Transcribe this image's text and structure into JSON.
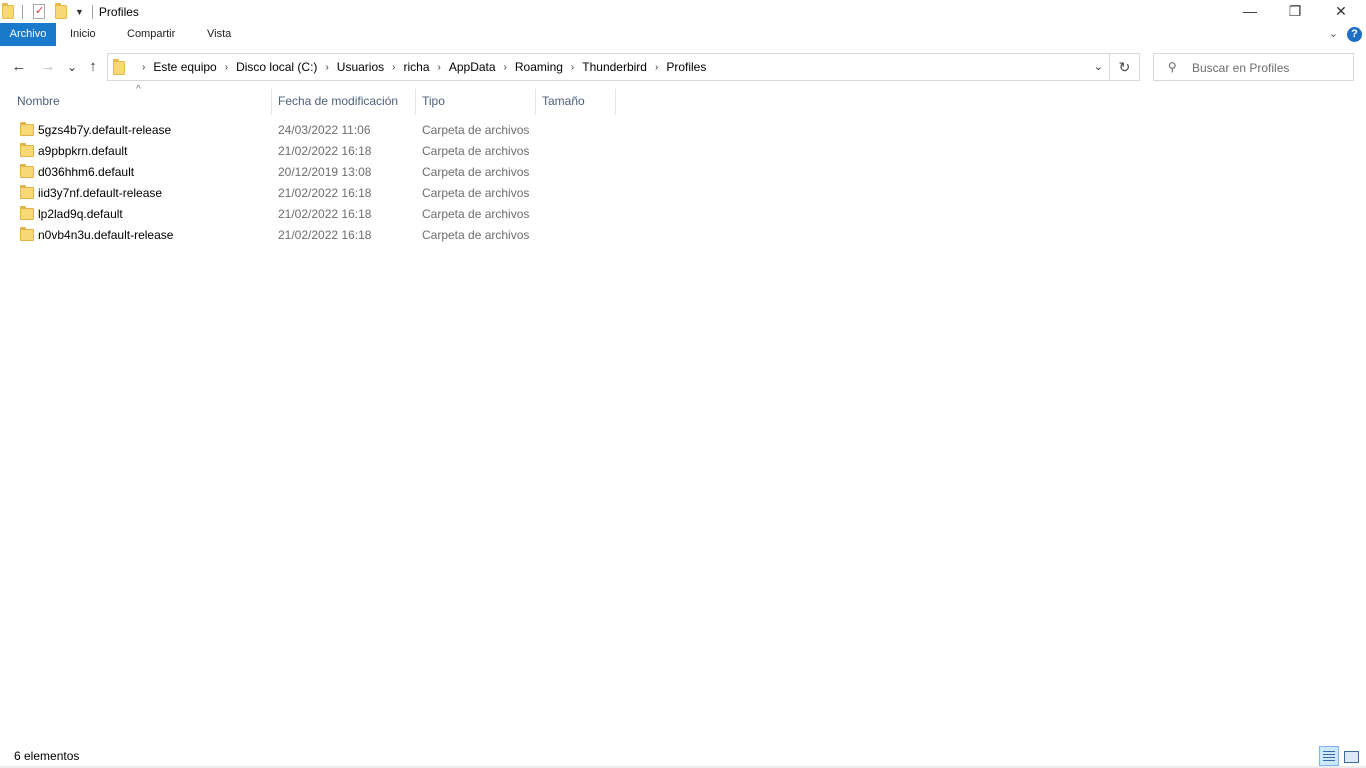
{
  "window": {
    "title": "Profiles",
    "minimize_glyph": "—",
    "restore_glyph": "❐",
    "close_glyph": "✕"
  },
  "ribbon": {
    "file_tab": "Archivo",
    "tabs": [
      "Inicio",
      "Compartir",
      "Vista"
    ],
    "help_glyph": "?"
  },
  "navigation": {
    "back": "←",
    "forward": "→",
    "recent": "⌄",
    "up": "↑"
  },
  "address": {
    "breadcrumbs": [
      "Este equipo",
      "Disco local (C:)",
      "Usuarios",
      "richa",
      "AppData",
      "Roaming",
      "Thunderbird",
      "Profiles"
    ],
    "refresh_glyph": "↻"
  },
  "search": {
    "placeholder": "Buscar en Profiles",
    "icon": "search-icon"
  },
  "columns": {
    "name": "Nombre",
    "modified": "Fecha de modificación",
    "type": "Tipo",
    "size": "Tamaño",
    "sort_glyph": "^"
  },
  "files": [
    {
      "name": "5gzs4b7y.default-release",
      "modified": "24/03/2022 11:06",
      "type": "Carpeta de archivos"
    },
    {
      "name": "a9pbpkrn.default",
      "modified": "21/02/2022 16:18",
      "type": "Carpeta de archivos"
    },
    {
      "name": "d036hhm6.default",
      "modified": "20/12/2019 13:08",
      "type": "Carpeta de archivos"
    },
    {
      "name": "iid3y7nf.default-release",
      "modified": "21/02/2022 16:18",
      "type": "Carpeta de archivos"
    },
    {
      "name": "lp2lad9q.default",
      "modified": "21/02/2022 16:18",
      "type": "Carpeta de archivos"
    },
    {
      "name": "n0vb4n3u.default-release",
      "modified": "21/02/2022 16:18",
      "type": "Carpeta de archivos"
    }
  ],
  "status": {
    "item_count": "6 elementos"
  },
  "colors": {
    "file_tab": "#1979ca",
    "folder": "#f8d775",
    "header_text": "#4c607a",
    "secondary_text": "#6d6d6d"
  }
}
